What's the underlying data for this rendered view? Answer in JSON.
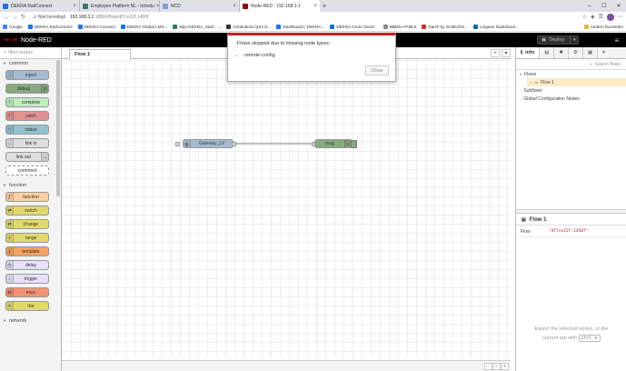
{
  "browser": {
    "tabs": [
      {
        "title": "DEKRA RailConnect",
        "color": "#1a73e8"
      },
      {
        "title": "Employee Platform NL - Introdu",
        "color": "#2e7d6b"
      },
      {
        "title": "NCD",
        "color": "#7c9fd4"
      },
      {
        "title": "Node-RED : 192.168.3.1",
        "color": "#8f0000"
      }
    ],
    "security": "Niet beveiligd",
    "url_host": "192.168.3.1",
    "url_path": ":1880/#flow/df7ce22f.1450f",
    "bookmarks": [
      "Google",
      "DEKRA RailConnect",
      "DEKRA Connect",
      "DEKRA Global LMS...",
      "Mijn-DEKRA_Start - ...",
      "AISolutions QX2 D...",
      "Dashboard | DEKRA...",
      "DEKRA Azure DevO...",
      "BBMS-HTML5",
      "Dan® by Goldschm...",
      "Linguee Nederland..."
    ],
    "bookmarks_other": "Andere favorieten"
  },
  "app": {
    "title": "Node-RED",
    "deploy_label": "Deploy"
  },
  "palette": {
    "filter_placeholder": "filter nodes",
    "categories": [
      {
        "name": "common",
        "nodes": [
          {
            "label": "inject",
            "color": "#a6bbcf",
            "icon": "→",
            "side": "left"
          },
          {
            "label": "debug",
            "color": "#87a980",
            "icon": "≡",
            "side": "right"
          },
          {
            "label": "complete",
            "color": "#c0edc0",
            "icon": "!",
            "side": "left"
          },
          {
            "label": "catch",
            "color": "#e49191",
            "icon": "!",
            "side": "left"
          },
          {
            "label": "status",
            "color": "#94c1d0",
            "icon": "~",
            "side": "left"
          },
          {
            "label": "link in",
            "color": "#dddddd",
            "icon": "→",
            "side": "left"
          },
          {
            "label": "link out",
            "color": "#dddddd",
            "icon": "→",
            "side": "right"
          },
          {
            "label": "comment",
            "color": "#ffffff",
            "icon": "",
            "side": "left"
          }
        ]
      },
      {
        "name": "function",
        "nodes": [
          {
            "label": "function",
            "color": "#fdd0a2",
            "icon": "ƒ",
            "side": "left"
          },
          {
            "label": "switch",
            "color": "#e2d96e",
            "icon": "⇄",
            "side": "left"
          },
          {
            "label": "change",
            "color": "#e2d96e",
            "icon": "⇄",
            "side": "left"
          },
          {
            "label": "range",
            "color": "#e2d96e",
            "icon": "i",
            "side": "left"
          },
          {
            "label": "template",
            "color": "#f4a460",
            "icon": "{",
            "side": "left"
          },
          {
            "label": "delay",
            "color": "#e6e0f8",
            "icon": "◷",
            "side": "left"
          },
          {
            "label": "trigger",
            "color": "#e6e0f8",
            "icon": "↓",
            "side": "left"
          },
          {
            "label": "exec",
            "color": "#f09373",
            "icon": "⚙",
            "side": "left"
          },
          {
            "label": "rbe",
            "color": "#e2d96e",
            "icon": "≠",
            "side": "left"
          }
        ]
      },
      {
        "name": "network",
        "nodes": []
      }
    ]
  },
  "workspace": {
    "tab_label": "Flow 1",
    "nodes": [
      {
        "label": "Gateway_LV",
        "color": "#a6bbcf"
      },
      {
        "label": "msg",
        "color": "#87a980"
      }
    ]
  },
  "notification": {
    "message": "Flows stopped due to missing node types.",
    "items": [
      "remote-config"
    ],
    "close_label": "Close"
  },
  "sidebar": {
    "tab_info": "info",
    "search_placeholder": "Search flows",
    "tree": {
      "flows": "Flows",
      "flow1": "Flow 1",
      "subflows": "Subflows",
      "global": "Global Configuration Nodes"
    },
    "info_title": "Flow 1",
    "prop_key": "Flow",
    "prop_value": "\"df7ce22f.1450f\"",
    "help_line1": "Export the selected nodes, or the",
    "help_line2": "current tab with",
    "help_kbd": "ctrl-e"
  }
}
